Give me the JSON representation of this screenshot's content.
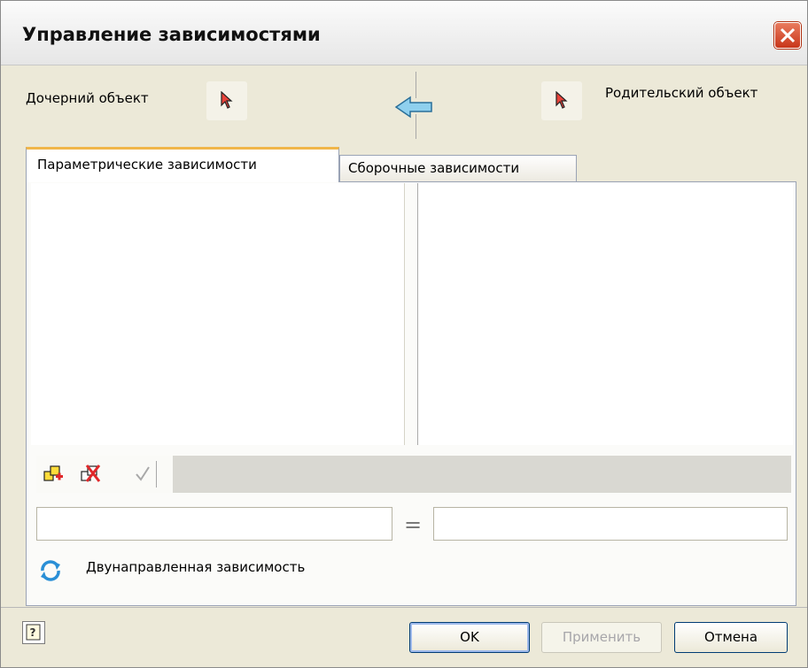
{
  "window": {
    "title": "Управление зависимостями"
  },
  "objects": {
    "child_label": "Дочерний объект",
    "parent_label": "Родительский объект"
  },
  "tabs": [
    {
      "label": "Параметрические зависимости",
      "active": true
    },
    {
      "label": "Сборочные зависимости",
      "active": false
    }
  ],
  "toolbar": {
    "icons": [
      "add-dependency-icon",
      "delete-dependency-icon",
      "apply-check-icon"
    ]
  },
  "expression": {
    "left_value": "",
    "equals_sign": "=",
    "right_value": ""
  },
  "bidirectional": {
    "label": "Двунаправленная зависимость"
  },
  "footer": {
    "ok_label": "OK",
    "apply_label": "Применить",
    "cancel_label": "Отмена"
  },
  "colors": {
    "dialog_bg": "#ece9d8",
    "active_tab_accent": "#f0b64a",
    "close_button": "#d4532f",
    "arrow_fill": "#8fd0ee",
    "cursor_red": "#e8433a"
  }
}
